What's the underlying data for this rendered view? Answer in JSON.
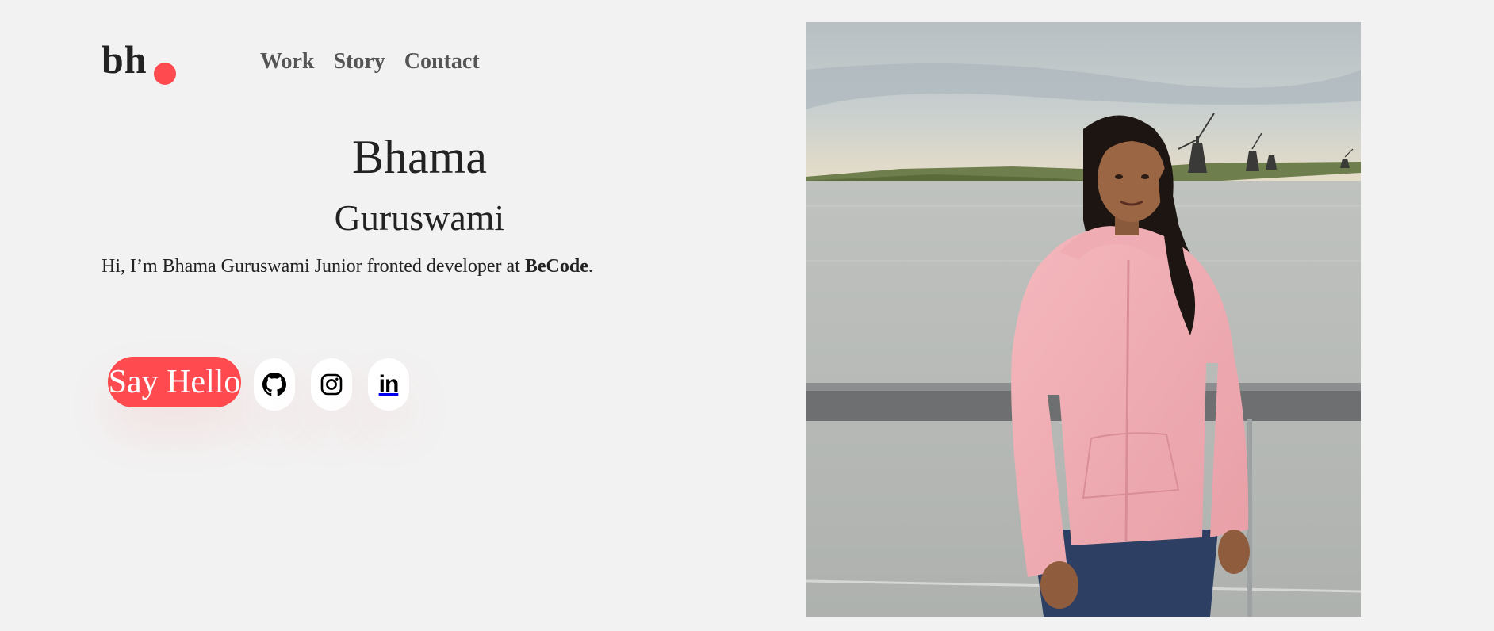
{
  "header": {
    "logo_text": "bh",
    "nav": [
      {
        "label": "Work"
      },
      {
        "label": "Story"
      },
      {
        "label": "Contact"
      }
    ]
  },
  "hero": {
    "first_name": "Bhama",
    "last_name": "Guruswami",
    "intro_prefix": "Hi, I’m Bhama Guruswami Junior fronted developer at ",
    "intro_company": "BeCode",
    "intro_suffix": "."
  },
  "actions": {
    "say_hello_label": "Say Hello",
    "social": [
      {
        "icon": "github-icon"
      },
      {
        "icon": "instagram-icon"
      },
      {
        "icon": "linkedin-icon",
        "text": "in"
      }
    ]
  },
  "photo": {
    "subject": "portrait-photo"
  },
  "colors": {
    "accent": "#ff4a4f",
    "background": "#f2f2f2",
    "text": "#222222",
    "nav_text": "#555555"
  }
}
